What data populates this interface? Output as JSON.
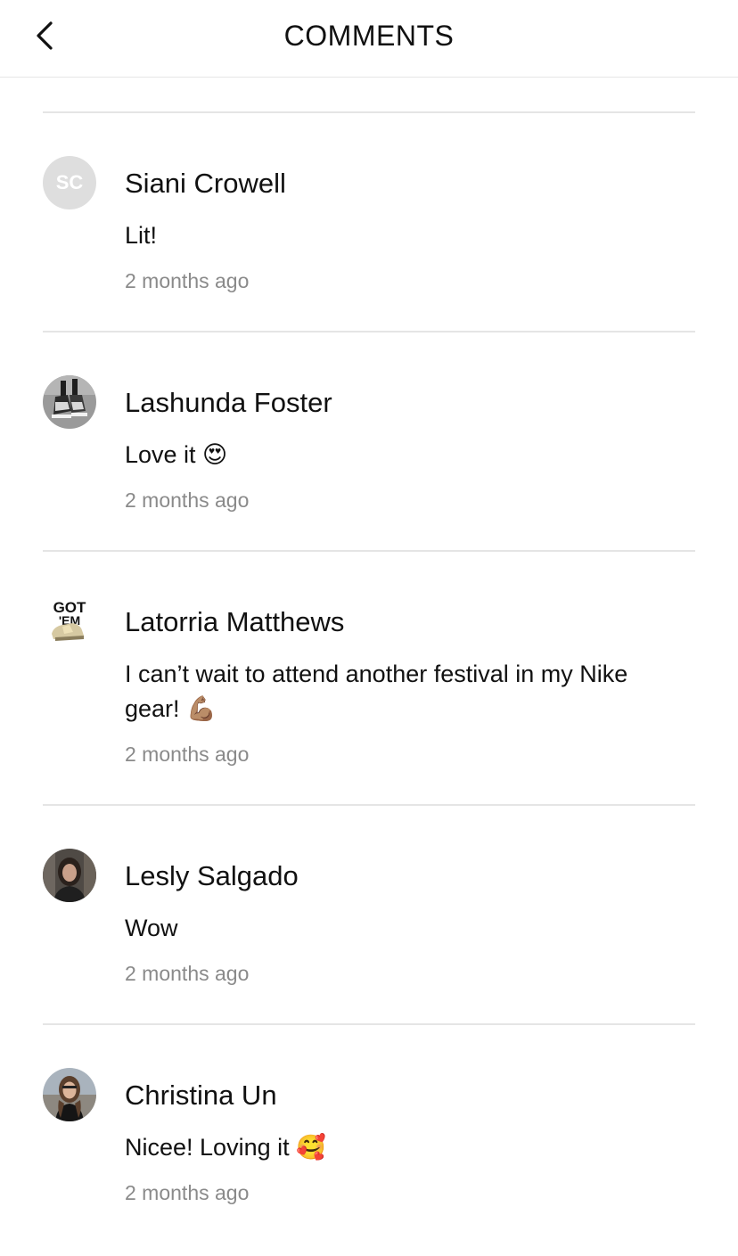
{
  "header": {
    "title": "COMMENTS",
    "back_icon": "chevron-left-icon"
  },
  "comments": [
    {
      "name": "Siani Crowell",
      "initials": "SC",
      "avatar_type": "initials",
      "text": "Lit!",
      "time": "2 months ago"
    },
    {
      "name": "Lashunda Foster",
      "avatar_type": "photo-sneakers",
      "text": "Love it 😍",
      "time": "2 months ago"
    },
    {
      "name": "Latorria Matthews",
      "avatar_type": "got-em-logo",
      "avatar_text": "GOT 'EM",
      "text": "I can’t wait to attend another festival in my Nike gear! 💪🏽",
      "time": "2 months ago"
    },
    {
      "name": "Lesly Salgado",
      "avatar_type": "photo-person",
      "text": "Wow",
      "time": "2 months ago"
    },
    {
      "name": "Christina Un",
      "avatar_type": "photo-person-city",
      "text": "Nicee!  Loving it 🥰",
      "time": "2 months ago"
    }
  ],
  "colors": {
    "divider": "#e5e5e5",
    "timestamp": "#8a8a8a",
    "initials_bg": "#dedede"
  }
}
